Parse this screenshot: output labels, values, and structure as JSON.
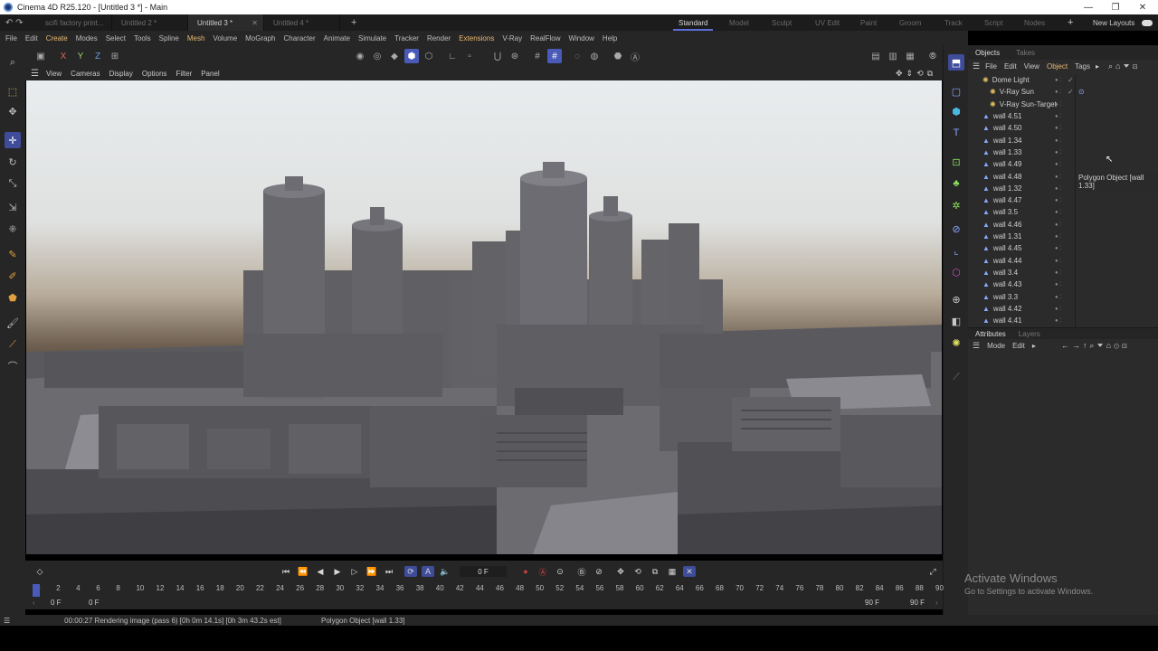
{
  "window": {
    "title": "Cinema 4D R25.120 - [Untitled 3 *] - Main",
    "min": "—",
    "max": "❐",
    "close": "✕"
  },
  "doc_tabs": [
    {
      "label": "scifi factory print..."
    },
    {
      "label": "Untitled 2 *"
    },
    {
      "label": "Untitled 3 *"
    },
    {
      "label": "Untitled 4 *"
    }
  ],
  "new_tab": "+",
  "layout_tabs": [
    "Standard",
    "Model",
    "Sculpt",
    "UV Edit",
    "Paint",
    "Groom",
    "Track",
    "Script",
    "Nodes"
  ],
  "layouts_plus": "+",
  "new_layouts": "New Layouts",
  "menu": [
    "File",
    "Edit",
    "Create",
    "Modes",
    "Select",
    "Tools",
    "Spline",
    "Mesh",
    "Volume",
    "MoGraph",
    "Character",
    "Animate",
    "Simulate",
    "Tracker",
    "Render",
    "Extensions",
    "V-Ray",
    "RealFlow",
    "Window",
    "Help"
  ],
  "axes": {
    "x": "X",
    "y": "Y",
    "z": "Z"
  },
  "viewport_menu": [
    "View",
    "Cameras",
    "Display",
    "Options",
    "Filter",
    "Panel"
  ],
  "objects": {
    "tabs": [
      "Objects",
      "Takes"
    ],
    "menu": [
      "File",
      "Edit",
      "View",
      "Object",
      "Tags"
    ],
    "items": [
      {
        "name": "Dome Light",
        "depth": 0
      },
      {
        "name": "V-Ray Sun",
        "depth": 1
      },
      {
        "name": "V-Ray Sun-Target",
        "depth": 1
      },
      {
        "name": "wall 4.51",
        "depth": 0
      },
      {
        "name": "wall 4.50",
        "depth": 0
      },
      {
        "name": "wall 1.34",
        "depth": 0
      },
      {
        "name": "wall 1.33",
        "depth": 0
      },
      {
        "name": "wall 4.49",
        "depth": 0
      },
      {
        "name": "wall 4.48",
        "depth": 0
      },
      {
        "name": "wall 1.32",
        "depth": 0
      },
      {
        "name": "wall 4.47",
        "depth": 0
      },
      {
        "name": "wall 3.5",
        "depth": 0
      },
      {
        "name": "wall 4.46",
        "depth": 0
      },
      {
        "name": "wall 1.31",
        "depth": 0
      },
      {
        "name": "wall 4.45",
        "depth": 0
      },
      {
        "name": "wall 4.44",
        "depth": 0
      },
      {
        "name": "wall 3.4",
        "depth": 0
      },
      {
        "name": "wall 4.43",
        "depth": 0
      },
      {
        "name": "wall 3.3",
        "depth": 0
      },
      {
        "name": "wall 4.42",
        "depth": 0
      },
      {
        "name": "wall 4.41",
        "depth": 0
      }
    ],
    "tooltip": "Polygon Object [wall 1.33]"
  },
  "attributes": {
    "tabs": [
      "Attributes",
      "Layers"
    ],
    "menu": [
      "Mode",
      "Edit"
    ]
  },
  "timeline": {
    "current_frame": "0 F",
    "ticks": [
      "0",
      "2",
      "4",
      "6",
      "8",
      "10",
      "12",
      "14",
      "16",
      "18",
      "20",
      "22",
      "24",
      "26",
      "28",
      "30",
      "32",
      "34",
      "36",
      "38",
      "40",
      "42",
      "44",
      "46",
      "48",
      "50",
      "52",
      "54",
      "56",
      "58",
      "60",
      "62",
      "64",
      "66",
      "68",
      "70",
      "72",
      "74",
      "76",
      "78",
      "80",
      "82",
      "84",
      "86",
      "88",
      "90"
    ],
    "range_start": "0 F",
    "range_start2": "0 F",
    "range_end": "90 F",
    "range_end2": "90 F"
  },
  "status": {
    "render": "00:00:27 Rendering image (pass 6) [0h  0m 14.1s] [0h  3m 43.2s est]",
    "object": "Polygon Object [wall 1.33]"
  },
  "watermark": {
    "title": "Activate Windows",
    "subtitle": "Go to Settings to activate Windows."
  }
}
